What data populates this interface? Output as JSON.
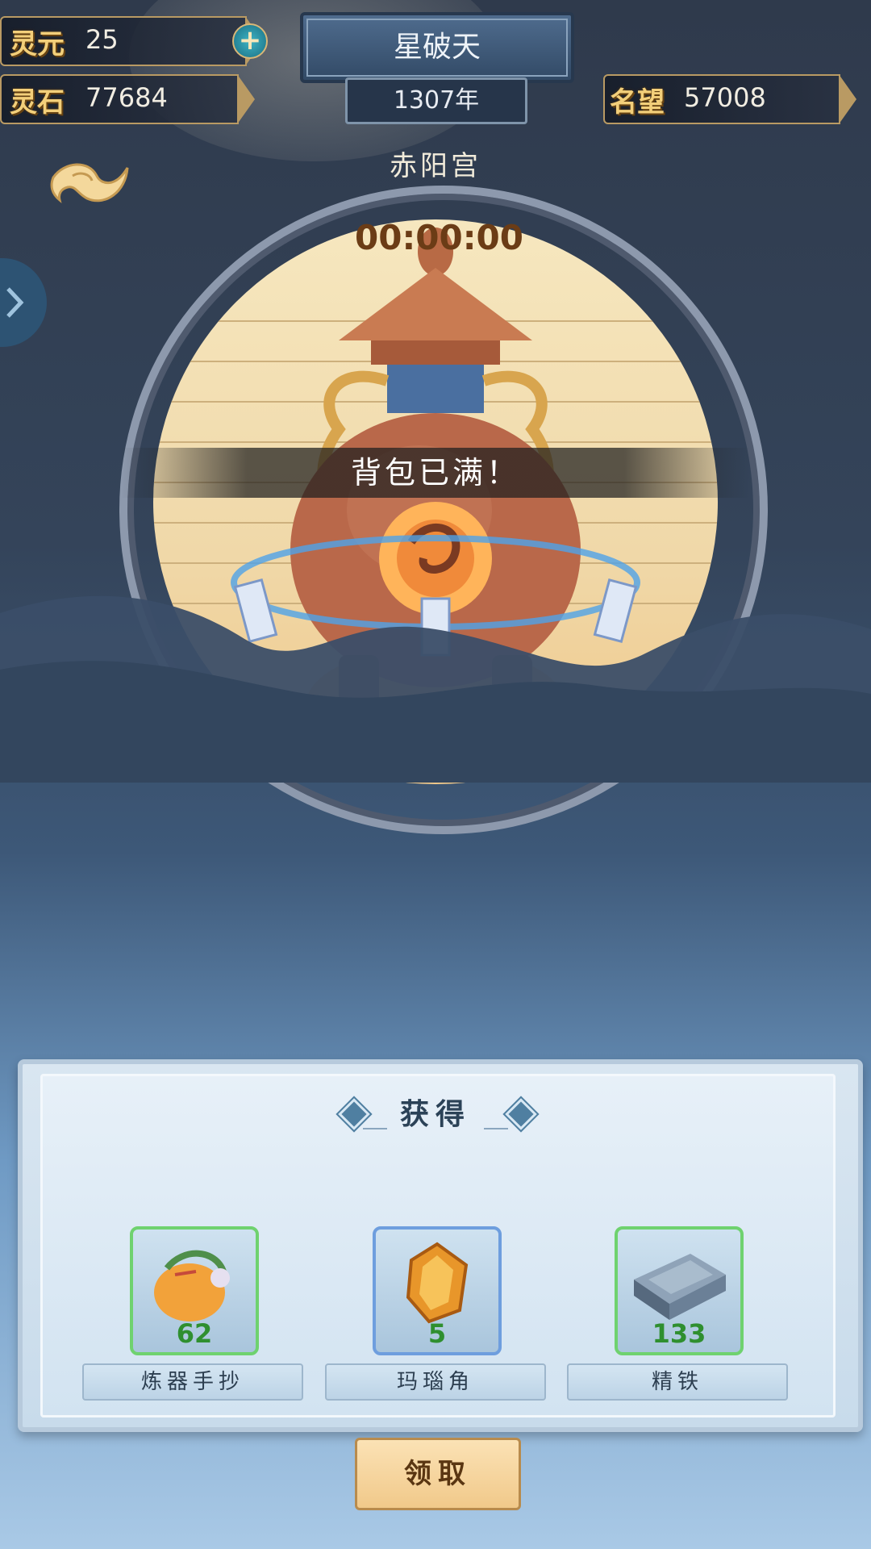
{
  "header": {
    "lingyuan_label": "灵元",
    "lingyuan_value": "25",
    "lingshi_label": "灵石",
    "lingshi_value": "77684",
    "title": "星破天",
    "year": "1307年",
    "mingwang_label": "名望",
    "mingwang_value": "57008"
  },
  "palace": {
    "name": "赤阳宫",
    "timer": "00:00:00"
  },
  "toast": "背包已满！",
  "reward_panel": {
    "title": "获得",
    "items": [
      {
        "name": "炼器手抄",
        "count": "62",
        "rarity": "green"
      },
      {
        "name": "玛瑙角",
        "count": "5",
        "rarity": "blue"
      },
      {
        "name": "精铁",
        "count": "133",
        "rarity": "green"
      }
    ],
    "claim_label": "领取"
  }
}
